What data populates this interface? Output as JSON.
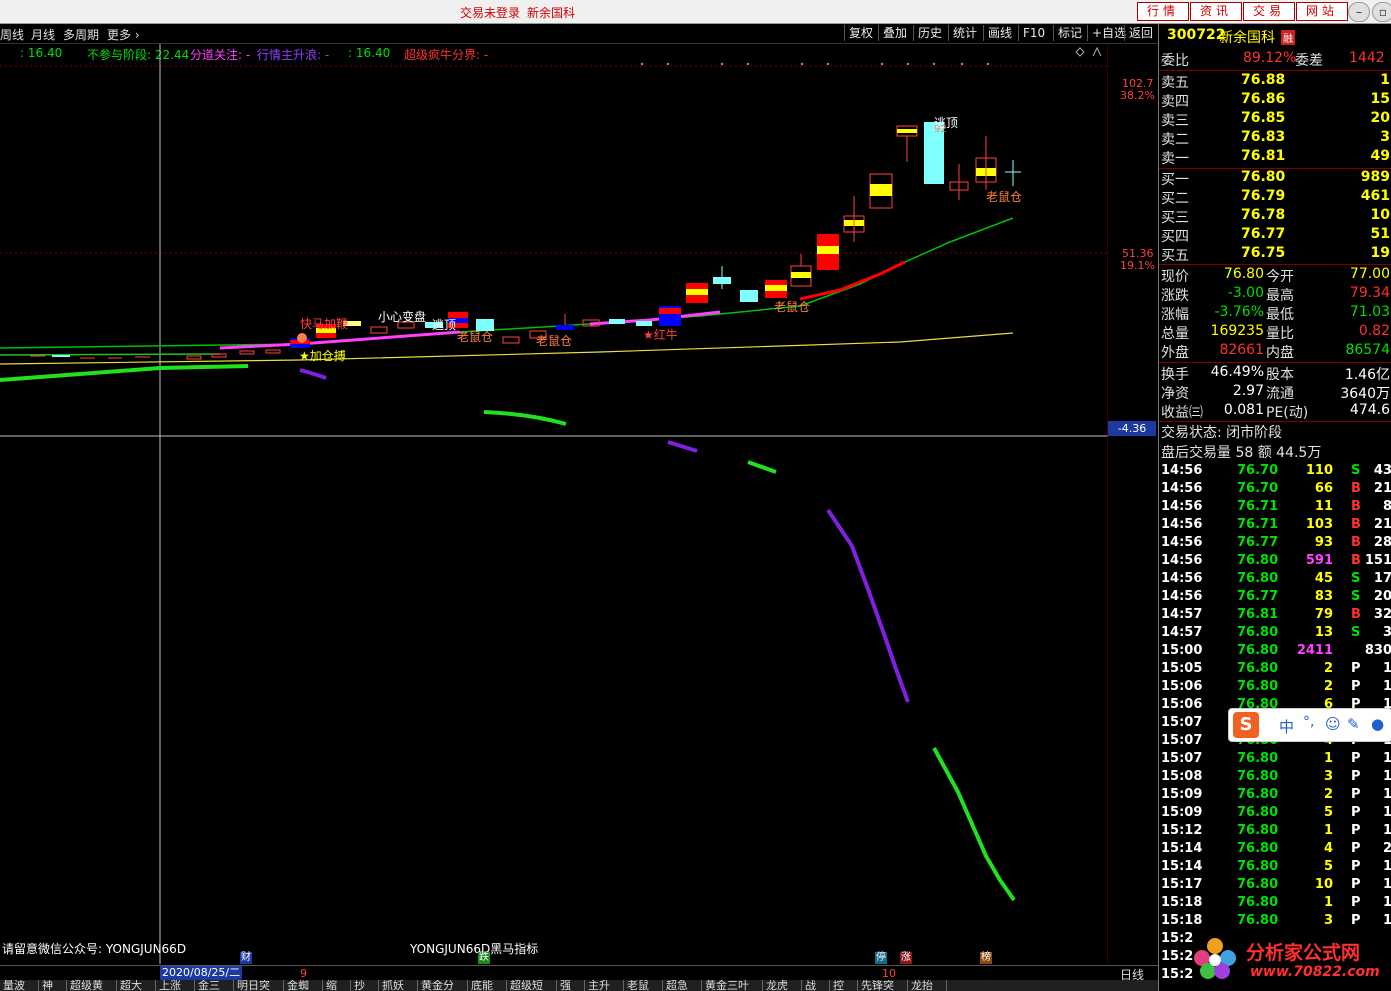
{
  "titlebar": {
    "status": "交易未登录",
    "stock_name": "新余国科",
    "nav": [
      "行情",
      "资讯",
      "交易",
      "网站"
    ]
  },
  "toolbar": {
    "left_items": [
      "周线",
      "月线",
      "多周期",
      "更多"
    ],
    "right_items": [
      "复权",
      "叠加",
      "历史",
      "统计",
      "画线",
      "F10",
      "标记",
      "+自选",
      "返回"
    ]
  },
  "legend": {
    "val1": ": 16.40",
    "item2": "不参与阶段: 22.44",
    "item3": "分道关注: -",
    "item4": "行情主升浪: -",
    "val5": ": 16.40",
    "item6": "超级疯牛分界: -"
  },
  "axis": {
    "top_price": "102.7",
    "top_pct": "38.2%",
    "mid_price": "51.36",
    "mid_pct": "19.1%",
    "cursor_value": "-4.36"
  },
  "annotations": {
    "kuaima": "快马加鞭",
    "xiaoxin": "小心变盘",
    "taoding1": "逃顶",
    "laoshu1": "老鼠仓",
    "laoshu2": "老鼠仓",
    "hongniu": "红牛",
    "laoshu3": "老鼠仓",
    "taoding2": "逃顶",
    "laoshu4": "老鼠仓",
    "jiama": "加仓搏",
    "price_tag": "92"
  },
  "bottom": {
    "wechat": "请留意微信公众号: YONGJUN66D",
    "indicator": "YONGJUN66D黑马指标",
    "badge_cai": "财",
    "badge_die": "跌",
    "badge_ting": "停",
    "badge_zhang": "涨",
    "badge_bang": "榜",
    "date": "2020/08/25/二",
    "month9": "9",
    "month10": "10",
    "period": "日线"
  },
  "tabs": [
    "量波段",
    "神龙",
    "超级黄金",
    "超大牛",
    "上涨买",
    "金三角",
    "明日突破",
    "金蜘蛛",
    "缩量",
    "抄底",
    "抓妖股",
    "黄金分割",
    "底能通",
    "超级短牛",
    "强化",
    "主升浪",
    "老鼠仓",
    "超急买",
    "黄金三叶草",
    "龙虎榜",
    "战神",
    "控庄",
    "先锋突破",
    "龙抬头"
  ],
  "quote": {
    "code": "300722",
    "name": "新余国科",
    "badge": "融",
    "weibi_label": "委比",
    "weibi": "89.12%",
    "weicha_label": "委差",
    "weicha": "1442",
    "asks": [
      {
        "label": "卖五",
        "price": "76.88",
        "vol": "1"
      },
      {
        "label": "卖四",
        "price": "76.86",
        "vol": "15"
      },
      {
        "label": "卖三",
        "price": "76.85",
        "vol": "20"
      },
      {
        "label": "卖二",
        "price": "76.83",
        "vol": "3"
      },
      {
        "label": "卖一",
        "price": "76.81",
        "vol": "49"
      }
    ],
    "bids": [
      {
        "label": "买一",
        "price": "76.80",
        "vol": "989"
      },
      {
        "label": "买二",
        "price": "76.79",
        "vol": "461"
      },
      {
        "label": "买三",
        "price": "76.78",
        "vol": "10"
      },
      {
        "label": "买四",
        "price": "76.77",
        "vol": "51"
      },
      {
        "label": "买五",
        "price": "76.75",
        "vol": "19"
      }
    ],
    "stats": [
      {
        "l1": "现价",
        "v1": "76.80",
        "l2": "今开",
        "v2": "77.00"
      },
      {
        "l1": "涨跌",
        "v1": "-3.00",
        "l2": "最高",
        "v2": "79.34"
      },
      {
        "l1": "涨幅",
        "v1": "-3.76%",
        "l2": "最低",
        "v2": "71.03"
      },
      {
        "l1": "总量",
        "v1": "169235",
        "l2": "量比",
        "v2": "0.82"
      },
      {
        "l1": "外盘",
        "v1": "82661",
        "l2": "内盘",
        "v2": "86574"
      }
    ],
    "stats2": [
      {
        "l1": "换手",
        "v1": "46.49%",
        "l2": "股本",
        "v2": "1.46亿"
      },
      {
        "l1": "净资",
        "v1": "2.97",
        "l2": "流通",
        "v2": "3640万"
      },
      {
        "l1": "收益㈢",
        "v1": "0.081",
        "l2": "PE(动)",
        "v2": "474.6"
      }
    ],
    "state": "交易状态: 闭市阶段",
    "after": "盘后交易量 58 额 44.5万",
    "ticks": [
      {
        "t": "14:56",
        "p": "76.70",
        "v": "110",
        "s": "S",
        "n": "43"
      },
      {
        "t": "14:56",
        "p": "76.70",
        "v": "66",
        "s": "B",
        "n": "21"
      },
      {
        "t": "14:56",
        "p": "76.71",
        "v": "11",
        "s": "B",
        "n": "8"
      },
      {
        "t": "14:56",
        "p": "76.71",
        "v": "103",
        "s": "B",
        "n": "21"
      },
      {
        "t": "14:56",
        "p": "76.77",
        "v": "93",
        "s": "B",
        "n": "28"
      },
      {
        "t": "14:56",
        "p": "76.80",
        "v": "591",
        "s": "B",
        "n": "151"
      },
      {
        "t": "14:56",
        "p": "76.80",
        "v": "45",
        "s": "S",
        "n": "17"
      },
      {
        "t": "14:56",
        "p": "76.77",
        "v": "83",
        "s": "S",
        "n": "20"
      },
      {
        "t": "14:57",
        "p": "76.81",
        "v": "79",
        "s": "B",
        "n": "32"
      },
      {
        "t": "14:57",
        "p": "76.80",
        "v": "13",
        "s": "S",
        "n": "3"
      },
      {
        "t": "15:00",
        "p": "76.80",
        "v": "2411",
        "s": "",
        "n": "830"
      },
      {
        "t": "15:05",
        "p": "76.80",
        "v": "2",
        "s": "P",
        "n": "1"
      },
      {
        "t": "15:06",
        "p": "76.80",
        "v": "2",
        "s": "P",
        "n": "1"
      },
      {
        "t": "15:06",
        "p": "76.80",
        "v": "6",
        "s": "P",
        "n": "1"
      },
      {
        "t": "15:07",
        "p": "76.80",
        "v": "",
        "s": "",
        "n": ""
      },
      {
        "t": "15:07",
        "p": "76.80",
        "v": "4",
        "s": "P",
        "n": "1"
      },
      {
        "t": "15:07",
        "p": "76.80",
        "v": "1",
        "s": "P",
        "n": "1"
      },
      {
        "t": "15:08",
        "p": "76.80",
        "v": "3",
        "s": "P",
        "n": "1"
      },
      {
        "t": "15:09",
        "p": "76.80",
        "v": "2",
        "s": "P",
        "n": "1"
      },
      {
        "t": "15:09",
        "p": "76.80",
        "v": "5",
        "s": "P",
        "n": "1"
      },
      {
        "t": "15:12",
        "p": "76.80",
        "v": "1",
        "s": "P",
        "n": "1"
      },
      {
        "t": "15:14",
        "p": "76.80",
        "v": "4",
        "s": "P",
        "n": "2"
      },
      {
        "t": "15:14",
        "p": "76.80",
        "v": "5",
        "s": "P",
        "n": "1"
      },
      {
        "t": "15:17",
        "p": "76.80",
        "v": "10",
        "s": "P",
        "n": "1"
      },
      {
        "t": "15:18",
        "p": "76.80",
        "v": "1",
        "s": "P",
        "n": "1"
      },
      {
        "t": "15:18",
        "p": "76.80",
        "v": "3",
        "s": "P",
        "n": "1"
      },
      {
        "t": "15:2",
        "p": "",
        "v": "",
        "s": "",
        "n": ""
      },
      {
        "t": "15:2",
        "p": "",
        "v": "",
        "s": "",
        "n": ""
      },
      {
        "t": "15:2",
        "p": "",
        "v": "",
        "s": "",
        "n": ""
      }
    ]
  },
  "ime": {
    "zh": "中",
    "punct": "°,"
  },
  "watermark": {
    "name": "分析家公式网",
    "url": "www.70822.com"
  }
}
